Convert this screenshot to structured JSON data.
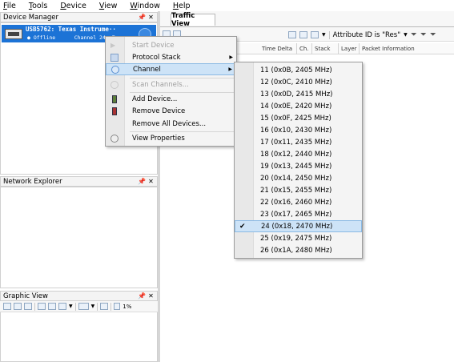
{
  "menubar": {
    "items": [
      "File",
      "Tools",
      "Device",
      "View",
      "Window",
      "Help"
    ],
    "underlined": [
      "F",
      "T",
      "D",
      "V",
      "W",
      "H"
    ]
  },
  "device_manager": {
    "title": "Device Manager",
    "device": {
      "name": "USB5762: Texas Instrume··",
      "status": "● Offline",
      "channel": "Channel 24, Z"
    }
  },
  "network_explorer": {
    "title": "Network Explorer"
  },
  "graphic_view": {
    "title": "Graphic View",
    "zoom": "1%"
  },
  "pane_controls": {
    "pin": "⬛",
    "close": "✕"
  },
  "traffic_view": {
    "tab": "Traffic View",
    "attribute_id": "Attribute ID is \"Res\"",
    "columns": [
      "Time Delta",
      "Ch.",
      "Stack",
      "Layer",
      "Packet Information"
    ]
  },
  "context_menu": {
    "items": [
      {
        "label": "Start Device",
        "disabled": true,
        "submenu": false,
        "icon": "play-icon"
      },
      {
        "label": "Protocol Stack",
        "disabled": false,
        "submenu": true,
        "icon": "stack-icon"
      },
      {
        "label": "Channel",
        "disabled": false,
        "submenu": true,
        "icon": "channel-icon",
        "highlighted": true
      },
      {
        "label": "Scan Channels...",
        "disabled": true,
        "submenu": false,
        "icon": "scan-icon"
      },
      {
        "label": "Add Device...",
        "disabled": false,
        "submenu": false,
        "icon": "add-device-icon"
      },
      {
        "label": "Remove Device",
        "disabled": false,
        "submenu": false,
        "icon": "remove-device-icon"
      },
      {
        "label": "Remove All Devices...",
        "disabled": false,
        "submenu": false,
        "icon": ""
      },
      {
        "label": "View Properties",
        "disabled": false,
        "submenu": false,
        "icon": "properties-icon"
      }
    ],
    "submenu_arrow": "▶"
  },
  "channel_submenu": {
    "selected_index": 13,
    "checkmark": "✔",
    "items": [
      "11 (0x0B, 2405 MHz)",
      "12 (0x0C, 2410 MHz)",
      "13 (0x0D, 2415 MHz)",
      "14 (0x0E, 2420 MHz)",
      "15 (0x0F, 2425 MHz)",
      "16 (0x10, 2430 MHz)",
      "17 (0x11, 2435 MHz)",
      "18 (0x12, 2440 MHz)",
      "19 (0x13, 2445 MHz)",
      "20 (0x14, 2450 MHz)",
      "21 (0x15, 2455 MHz)",
      "22 (0x16, 2460 MHz)",
      "23 (0x17, 2465 MHz)",
      "24 (0x18, 2470 MHz)",
      "25 (0x19, 2475 MHz)",
      "26 (0x1A, 2480 MHz)"
    ]
  },
  "colors": {
    "selection_blue": "#1c73d6",
    "menu_highlight": "#cde3f7",
    "menu_highlight_border": "#8ab9e4"
  }
}
